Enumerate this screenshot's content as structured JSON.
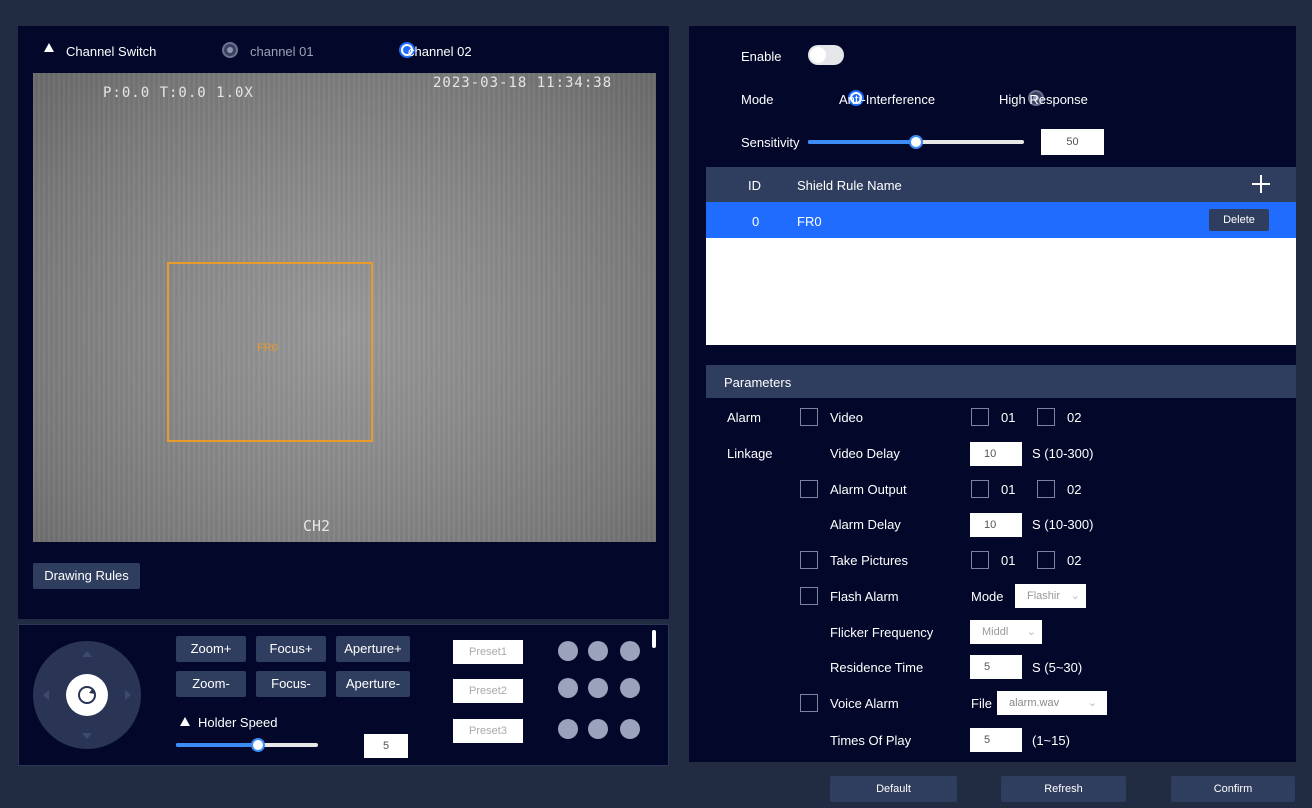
{
  "left": {
    "channel_switch_label": "Channel Switch",
    "channel_01": "channel 01",
    "channel_02": "channel 02",
    "selected_channel": "channel 02",
    "video": {
      "osd_ptz": "P:0.0 T:0.0 1.0X",
      "osd_timestamp": "2023-03-18 11:34:38",
      "osd_channel": "CH2",
      "region_label": "FR0",
      "region_color": "#e89a2c"
    },
    "drawing_rules_button": "Drawing Rules"
  },
  "ptz": {
    "buttons": [
      {
        "label": "Zoom+"
      },
      {
        "label": "Focus+"
      },
      {
        "label": "Aperture+"
      },
      {
        "label": "Zoom-"
      },
      {
        "label": "Focus-"
      },
      {
        "label": "Aperture-"
      }
    ],
    "holder_speed_label": "Holder Speed",
    "holder_speed_value": "5",
    "holder_speed_fraction": 0.58,
    "presets": [
      "Preset1",
      "Preset2",
      "Preset3"
    ]
  },
  "right": {
    "enable_label": "Enable",
    "enable_on": false,
    "mode_label": "Mode",
    "mode_anti": "Anti-Interference",
    "mode_high": "High Response",
    "mode_selected": "Anti-Interference",
    "sensitivity_label": "Sensitivity",
    "sensitivity_value": "50",
    "sensitivity_fraction": 0.5,
    "table": {
      "col_id": "ID",
      "col_name": "Shield Rule Name",
      "add_icon": "plus-icon",
      "rows": [
        {
          "id": "0",
          "name": "FR0",
          "delete": "Delete"
        }
      ]
    },
    "params": {
      "title": "Parameters",
      "alarm": "Alarm",
      "linkage": "Linkage",
      "video": "Video",
      "opt01": "01",
      "opt02": "02",
      "video_delay": "Video Delay",
      "video_delay_value": "10",
      "video_delay_range": "S (10-300)",
      "alarm_output": "Alarm Output",
      "alarm_delay": "Alarm Delay",
      "alarm_delay_value": "10",
      "alarm_delay_range": "S (10-300)",
      "take_pictures": "Take Pictures",
      "flash_alarm": "Flash Alarm",
      "flash_mode_label": "Mode",
      "flash_mode_value": "Flashir",
      "flicker_frequency": "Flicker Frequency",
      "flicker_value": "Middl",
      "residence_time": "Residence Time",
      "residence_value": "5",
      "residence_range": "S (5~30)",
      "voice_alarm": "Voice Alarm",
      "file_label": "File",
      "file_value": "alarm.wav",
      "times_of_play": "Times Of Play",
      "times_value": "5",
      "times_range": "(1~15)"
    },
    "footer": {
      "default": "Default",
      "refresh": "Refresh",
      "confirm": "Confirm"
    }
  },
  "colors": {
    "accent": "#1f6cff",
    "panel": "#03082a",
    "background": "#212c42"
  }
}
